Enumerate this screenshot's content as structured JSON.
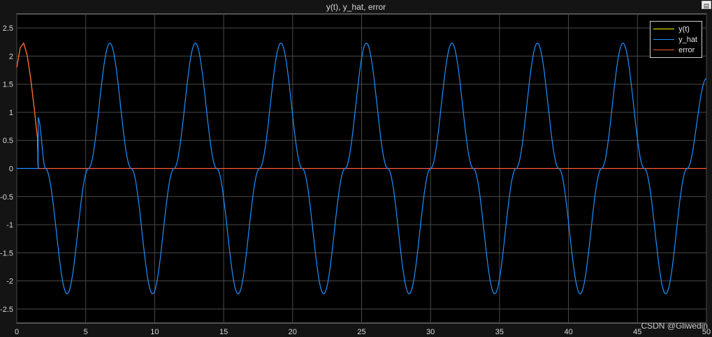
{
  "window": {
    "title": "y(t), y_hat, error"
  },
  "watermark": "CSDN @Gliwedin",
  "toolbar": {
    "expand_icon": "expand-icon"
  },
  "legend": {
    "items": [
      {
        "label": "y(t)",
        "color": "#ffff00"
      },
      {
        "label": "y_hat",
        "color": "#1e90ff"
      },
      {
        "label": "error",
        "color": "#ff5a36"
      }
    ]
  },
  "chart_data": {
    "type": "line",
    "title": "y(t), y_hat, error",
    "xlabel": "",
    "ylabel": "",
    "xlim": [
      0,
      50
    ],
    "ylim": [
      -2.75,
      2.75
    ],
    "grid": true,
    "legend_position": "top-right",
    "xticks": [
      0,
      5,
      10,
      15,
      20,
      25,
      30,
      35,
      40,
      45,
      50
    ],
    "yticks": [
      2.5,
      2,
      1.5,
      1,
      0.5,
      0,
      -0.5,
      -1,
      -1.5,
      -2,
      -2.5
    ],
    "series": [
      {
        "name": "y(t)",
        "color": "#ffff00",
        "x": [
          0,
          0.25,
          0.5,
          0.75,
          1.0,
          1.25,
          1.5,
          1.55
        ],
        "y": [
          1.8,
          2.15,
          2.23,
          2.02,
          1.62,
          1.1,
          0.55,
          0.0
        ]
      },
      {
        "name": "y_hat",
        "color": "#1e90ff",
        "x": [
          0,
          1.55,
          1.55,
          2.08,
          3.65,
          5.2,
          6.75,
          8.3,
          9.85,
          11.4,
          12.95,
          14.5,
          16.05,
          17.6,
          19.15,
          20.7,
          22.25,
          23.8,
          25.35,
          26.9,
          28.45,
          30.0,
          31.55,
          33.1,
          34.65,
          36.2,
          37.75,
          39.3,
          40.85,
          42.4,
          43.95,
          45.5,
          47.05,
          48.6,
          50
        ],
        "y": [
          0,
          0,
          0.9,
          0,
          -2.23,
          0,
          2.23,
          0,
          -2.23,
          0,
          2.23,
          0,
          -2.23,
          0,
          2.23,
          0,
          -2.23,
          0,
          2.23,
          0,
          -2.23,
          0,
          2.23,
          0,
          -2.23,
          0,
          2.23,
          0,
          -2.23,
          0,
          2.23,
          0,
          -2.23,
          0,
          1.6
        ]
      },
      {
        "name": "error",
        "color": "#ff5a36",
        "x": [
          0,
          0.25,
          0.5,
          0.75,
          1.0,
          1.25,
          1.5,
          1.55,
          50
        ],
        "y": [
          1.8,
          2.15,
          2.23,
          2.02,
          1.62,
          1.1,
          0.55,
          0,
          0
        ]
      }
    ]
  }
}
